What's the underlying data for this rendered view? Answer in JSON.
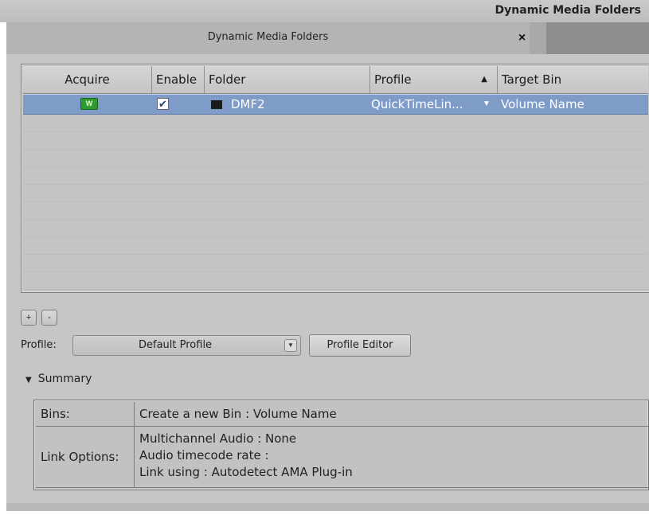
{
  "window": {
    "title": "Dynamic Media Folders",
    "tab_title": "Dynamic Media Folders",
    "close_glyph": "×"
  },
  "table": {
    "columns": [
      "Acquire",
      "Enable",
      "Folder",
      "Profile",
      "Target Bin"
    ],
    "sort_indicator": "▲",
    "rows": [
      {
        "acquire_icon": "acquire-icon",
        "acquire_icon_text": "W",
        "enabled": true,
        "check_glyph": "✔",
        "folder_icon": "folder-icon",
        "folder": "DMF2",
        "profile": "QuickTimeLin...",
        "profile_dropdown_glyph": "▼",
        "target_bin": "Volume Name"
      }
    ]
  },
  "buttons": {
    "add": "+",
    "remove": "-"
  },
  "profile": {
    "label": "Profile:",
    "selected": "Default Profile",
    "select_arrow": "▼",
    "editor_button": "Profile Editor"
  },
  "summary": {
    "toggle_glyph": "▼",
    "header": "Summary",
    "bins_key": "Bins:",
    "bins_value": "Create a new Bin : Volume Name",
    "link_key": "Link Options:",
    "link_lines": [
      "Multichannel Audio : None",
      "Audio timecode rate :",
      "Link using : Autodetect AMA Plug-in"
    ]
  },
  "colors": {
    "selection": "#7f9cc9",
    "panel": "#c6c6c6",
    "acquire_green": "#2f9a2f"
  }
}
